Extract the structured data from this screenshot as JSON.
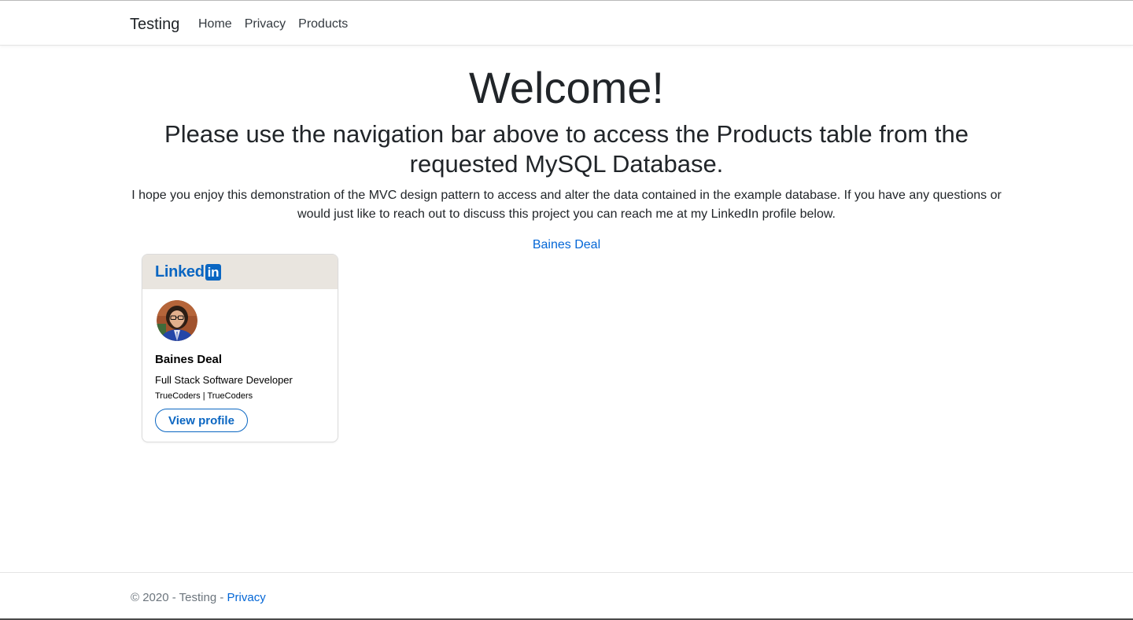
{
  "navbar": {
    "brand": "Testing",
    "links": [
      "Home",
      "Privacy",
      "Products"
    ]
  },
  "main": {
    "heading": "Welcome!",
    "subheading": "Please use the navigation bar above to access the Products table from the requested MySQL Database.",
    "intro": "I hope you enjoy this demonstration of the MVC design pattern to access and alter the data contained in the example database. If you have any questions or would just like to reach out to discuss this project you can reach me at my LinkedIn profile below.",
    "profile_link": "Baines Deal"
  },
  "badge": {
    "logo_text": "Linked",
    "logo_in": "in",
    "name": "Baines Deal",
    "title": "Full Stack Software Developer",
    "company": "TrueCoders | TrueCoders",
    "button": "View profile"
  },
  "footer": {
    "text": "© 2020 - Testing - ",
    "link": "Privacy"
  },
  "colors": {
    "link": "#0366d6",
    "linkedin_blue": "#0a66c2",
    "badge_header": "#e9e5df"
  }
}
